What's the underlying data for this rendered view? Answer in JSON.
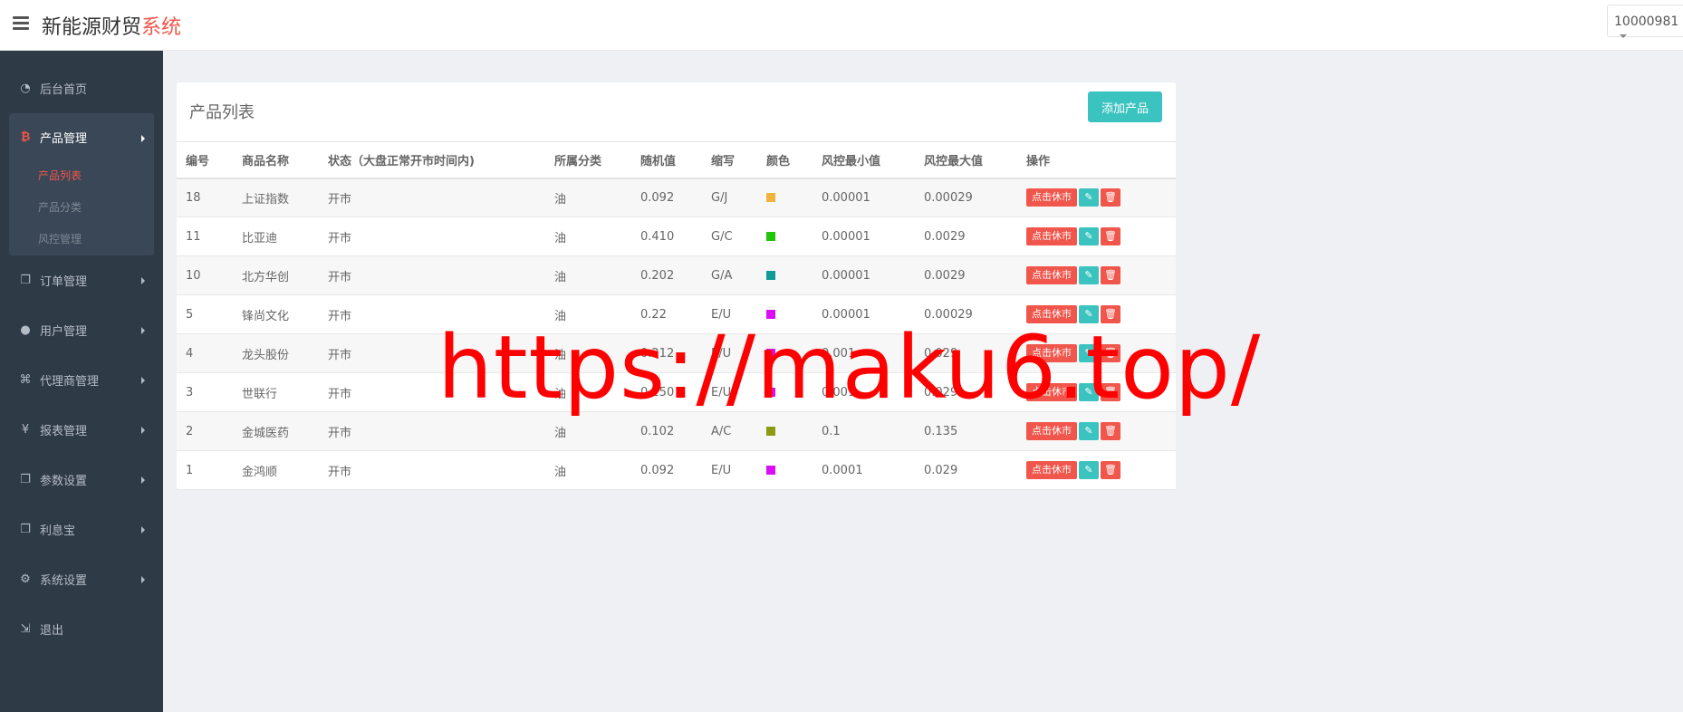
{
  "header": {
    "brand_main": "新能源财贸",
    "brand_accent": "系统",
    "user_id": "10000981"
  },
  "sidebar": {
    "items": [
      {
        "label": "后台首页",
        "icon": "dashboard-icon"
      },
      {
        "label": "产品管理",
        "icon": "bitcoin-icon"
      },
      {
        "label": "订单管理",
        "icon": "copy-icon"
      },
      {
        "label": "用户管理",
        "icon": "user-icon"
      },
      {
        "label": "代理商管理",
        "icon": "sitemap-icon"
      },
      {
        "label": "报表管理",
        "icon": "yen-icon"
      },
      {
        "label": "参数设置",
        "icon": "copy-icon"
      },
      {
        "label": "利息宝",
        "icon": "copy-icon"
      },
      {
        "label": "系统设置",
        "icon": "gears-icon"
      },
      {
        "label": "退出",
        "icon": "sign-out-icon"
      }
    ],
    "sub_items": [
      "产品列表",
      "产品分类",
      "风控管理"
    ]
  },
  "panel": {
    "title": "产品列表",
    "add_button": "添加产品"
  },
  "table": {
    "headers": [
      "编号",
      "商品名称",
      "状态（大盘正常开市时间内)",
      "所属分类",
      "随机值",
      "缩写",
      "颜色",
      "风控最小值",
      "风控最大值",
      "操作"
    ],
    "rest_button": "点击休市",
    "rows": [
      {
        "id": "18",
        "name": "上证指数",
        "status": "开市",
        "category": "油",
        "random": "0.092",
        "abbr": "G/J",
        "color": "#f1b33b",
        "min": "0.00001",
        "max": "0.00029"
      },
      {
        "id": "11",
        "name": "比亚迪",
        "status": "开市",
        "category": "油",
        "random": "0.410",
        "abbr": "G/C",
        "color": "#22c40c",
        "min": "0.00001",
        "max": "0.0029"
      },
      {
        "id": "10",
        "name": "北方华创",
        "status": "开市",
        "category": "油",
        "random": "0.202",
        "abbr": "G/A",
        "color": "#119a98",
        "min": "0.00001",
        "max": "0.0029"
      },
      {
        "id": "5",
        "name": "锋尚文化",
        "status": "开市",
        "category": "油",
        "random": "0.22",
        "abbr": "E/U",
        "color": "#d90ef2",
        "min": "0.00001",
        "max": "0.00029"
      },
      {
        "id": "4",
        "name": "龙头股份",
        "status": "开市",
        "category": "油",
        "random": "0.212",
        "abbr": "E/U",
        "color": "#d90ef2",
        "min": "0.001",
        "max": "0.029"
      },
      {
        "id": "3",
        "name": "世联行",
        "status": "开市",
        "category": "油",
        "random": "0.150",
        "abbr": "E/U",
        "color": "#d90ef2",
        "min": "0.001",
        "max": "0.029"
      },
      {
        "id": "2",
        "name": "金城医药",
        "status": "开市",
        "category": "油",
        "random": "0.102",
        "abbr": "A/C",
        "color": "#8a9a12",
        "min": "0.1",
        "max": "0.135"
      },
      {
        "id": "1",
        "name": "金鸿顺",
        "status": "开市",
        "category": "油",
        "random": "0.092",
        "abbr": "E/U",
        "color": "#d90ef2",
        "min": "0.0001",
        "max": "0.029"
      }
    ]
  },
  "watermark": "https://maku6.top/"
}
